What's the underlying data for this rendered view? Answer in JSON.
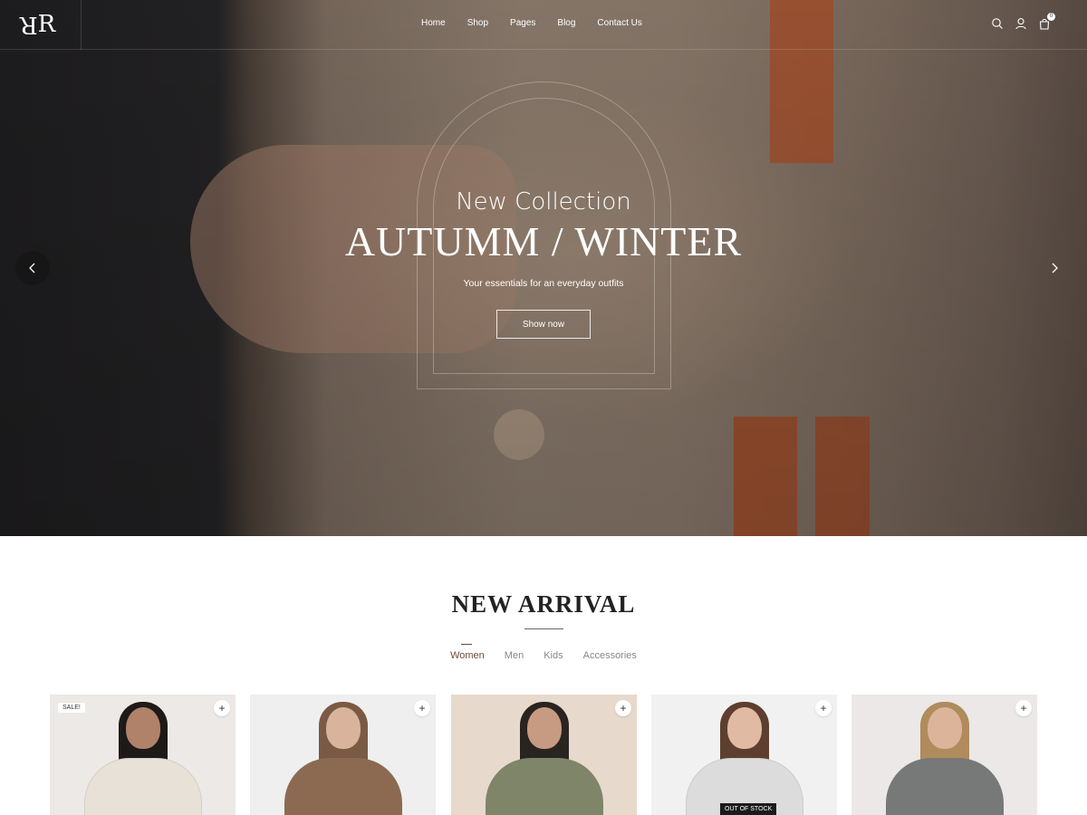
{
  "header": {
    "logo": "RR",
    "nav": [
      "Home",
      "Shop",
      "Pages",
      "Blog",
      "Contact Us"
    ],
    "cart_count": "0"
  },
  "hero": {
    "title_small": "New Collection",
    "title_big": "AUTUMM / WINTER",
    "subtitle": "Your essentials for an everyday outfits",
    "button": "Show now"
  },
  "arrivals": {
    "title": "NEW ARRIVAL",
    "tabs": [
      "Women",
      "Men",
      "Kids",
      "Accessories"
    ],
    "active_tab": "Women",
    "products": [
      {
        "badge": "SALE!",
        "plus": "+"
      },
      {
        "badge": "",
        "plus": "+"
      },
      {
        "badge": "",
        "plus": "+"
      },
      {
        "badge": "OUT OF STOCK",
        "plus": "+"
      },
      {
        "badge": "",
        "plus": "+"
      }
    ]
  },
  "colors": {
    "accent": "#6b4a3a",
    "hero_overlay": "#8b7b6d"
  }
}
